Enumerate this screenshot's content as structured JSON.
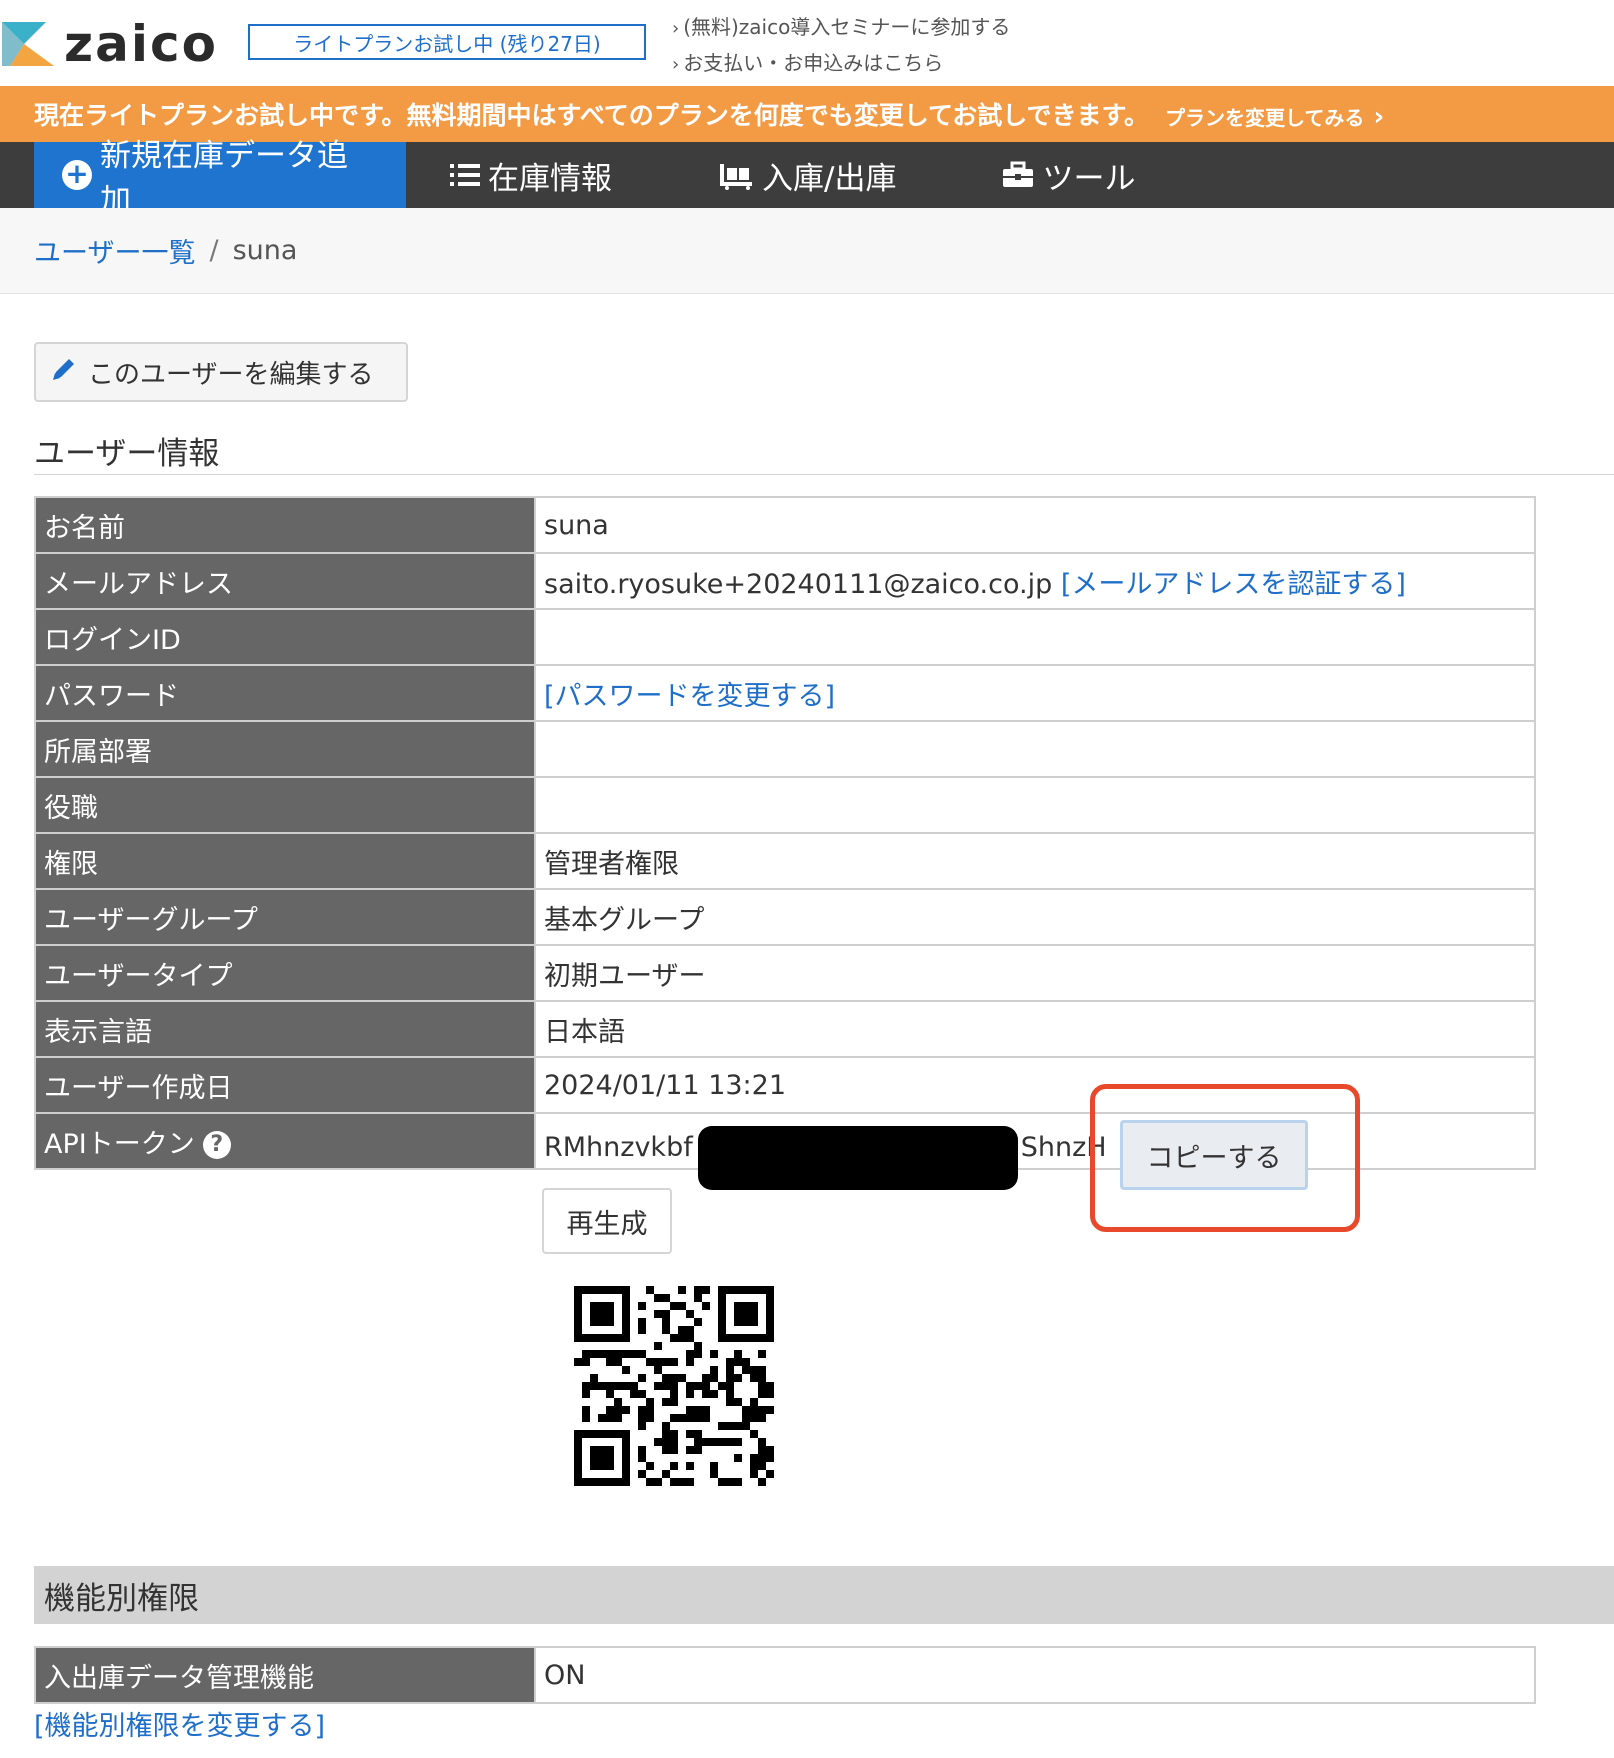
{
  "header": {
    "logo_text": "zaico",
    "trial_badge": "ライトプランお試し中 (残り27日)",
    "links": [
      "(無料)zaico導入セミナーに参加する",
      "お支払い・お申込みはこちら"
    ]
  },
  "banner": {
    "text": "現在ライトプランお試し中です。無料期間中はすべてのプランを何度でも変更してお試しできます。",
    "link": "プランを変更してみる"
  },
  "nav": {
    "items": [
      "新規在庫データ追加",
      "在庫情報",
      "入庫/出庫",
      "ツール"
    ]
  },
  "breadcrumb": {
    "parent": "ユーザー一覧",
    "separator": "/",
    "current": "suna"
  },
  "edit_button": "このユーザーを編集する",
  "section_title": "ユーザー情報",
  "rows": [
    {
      "label": "お名前",
      "value": "suna"
    },
    {
      "label": "メールアドレス",
      "value": "saito.ryosuke+20240111@zaico.co.jp",
      "link": "[メールアドレスを認証する]"
    },
    {
      "label": "ログインID",
      "value": ""
    },
    {
      "label": "パスワード",
      "value": "",
      "link": "[パスワードを変更する]"
    },
    {
      "label": "所属部署",
      "value": ""
    },
    {
      "label": "役職",
      "value": ""
    },
    {
      "label": "権限",
      "value": "管理者権限"
    },
    {
      "label": "ユーザーグループ",
      "value": "基本グループ"
    },
    {
      "label": "ユーザータイプ",
      "value": "初期ユーザー"
    },
    {
      "label": "表示言語",
      "value": "日本語"
    },
    {
      "label": "ユーザー作成日",
      "value": "2024/01/11 13:21"
    }
  ],
  "api_token": {
    "label": "APIトークン",
    "token_prefix": "RMhnzvkbf",
    "token_suffix": "ShnzH",
    "copy_button": "コピーする",
    "regenerate_button": "再生成"
  },
  "permissions": {
    "title": "機能別権限",
    "rows": [
      {
        "label": "入出庫データ管理機能",
        "value": "ON"
      }
    ],
    "change_link": "[機能別権限を変更する]"
  },
  "colors": {
    "brand_blue": "#1f74d0",
    "banner_orange": "#f39a45",
    "nav_dark": "#3d3d3d",
    "highlight_red": "#e8492a"
  }
}
